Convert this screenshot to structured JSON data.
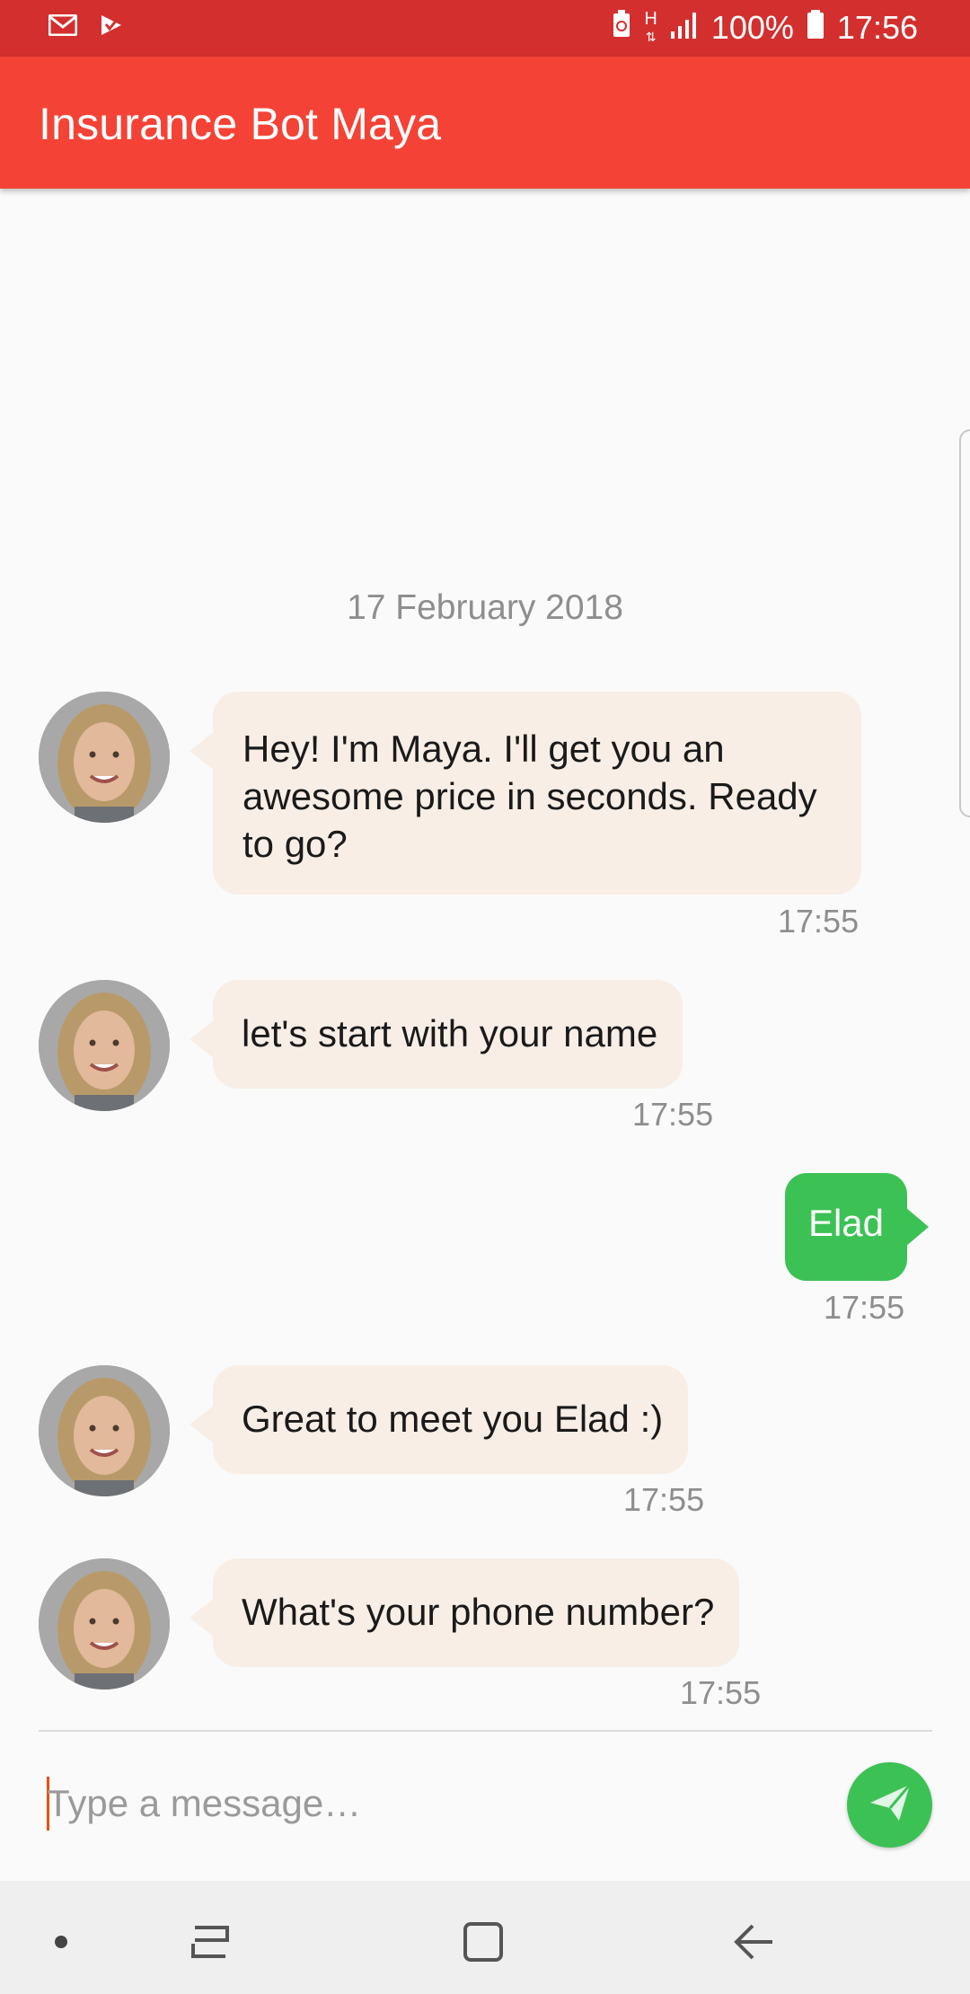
{
  "status_bar": {
    "battery_percent": "100%",
    "time": "17:56",
    "network": "H",
    "icons": [
      "gmail-icon",
      "inbox-icon",
      "battery-saver-icon",
      "h-network-icon",
      "signal-icon",
      "battery-icon"
    ]
  },
  "toolbar": {
    "title": "Insurance Bot Maya"
  },
  "chat": {
    "date_separator": "17 February 2018",
    "messages": [
      {
        "from": "bot",
        "text": "Hey! I'm Maya. I'll get you an awesome price in seconds. Ready to go?",
        "time": "17:55"
      },
      {
        "from": "bot",
        "text": "let's start with your name",
        "time": "17:55"
      },
      {
        "from": "user",
        "text": "Elad",
        "time": "17:55"
      },
      {
        "from": "bot",
        "text": "Great to meet you Elad :)",
        "time": "17:55"
      },
      {
        "from": "bot",
        "text": "What's your phone number?",
        "time": "17:55"
      }
    ]
  },
  "composer": {
    "placeholder": "Type a message…",
    "value": ""
  },
  "navbar": {
    "icons": [
      "dot-icon",
      "recents-icon",
      "home-icon",
      "back-icon"
    ]
  },
  "colors": {
    "status_bar": "#d32f2f",
    "toolbar": "#f44336",
    "bot_bubble": "#f8eee6",
    "user_bubble": "#3cc155",
    "send_button": "#3cc155"
  }
}
